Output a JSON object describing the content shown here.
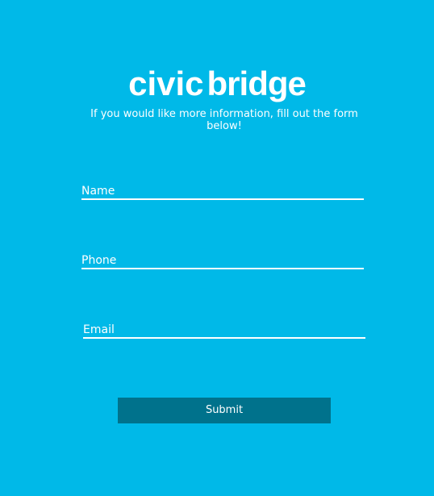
{
  "brand": {
    "logo_part1": "civic",
    "logo_part2": "bridge"
  },
  "intro_text": "If you would like more information, fill out the form below!",
  "form": {
    "name_placeholder": "Name",
    "phone_placeholder": "Phone",
    "email_placeholder": "Email",
    "submit_label": "Submit"
  },
  "colors": {
    "background": "#00b9e8",
    "button": "#00728c",
    "text": "#ffffff"
  }
}
